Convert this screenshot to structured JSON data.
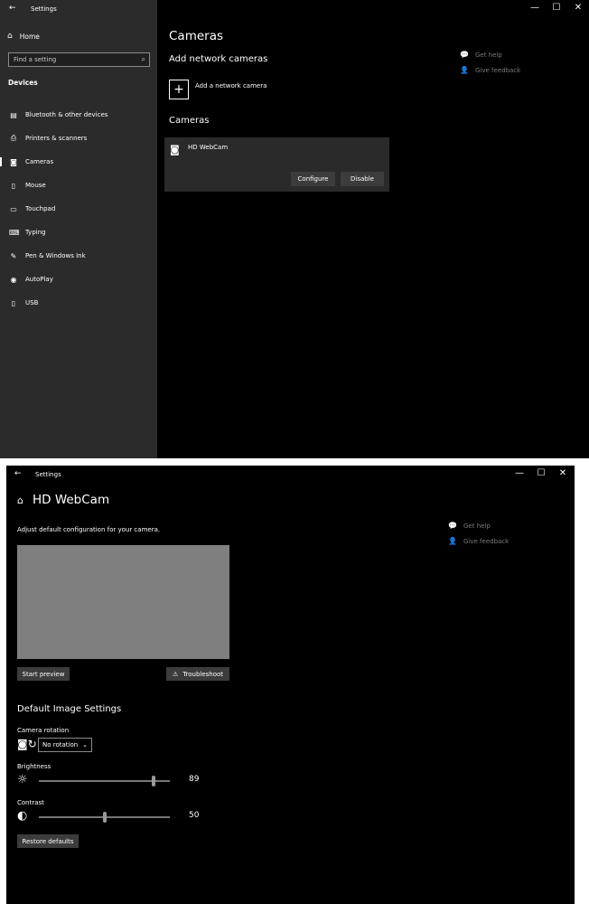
{
  "window1": {
    "title": "Settings",
    "controls": [
      "—",
      "☐",
      "✕"
    ],
    "sidebar": {
      "home": "Home",
      "search_placeholder": "Find a setting",
      "section": "Devices",
      "items": [
        {
          "icon": "bluetooth-icon",
          "glyph": "▤",
          "label": "Bluetooth & other devices"
        },
        {
          "icon": "printer-icon",
          "glyph": "⎙",
          "label": "Printers & scanners"
        },
        {
          "icon": "camera-icon",
          "glyph": "◙",
          "label": "Cameras"
        },
        {
          "icon": "mouse-icon",
          "glyph": "▯",
          "label": "Mouse"
        },
        {
          "icon": "touchpad-icon",
          "glyph": "▭",
          "label": "Touchpad"
        },
        {
          "icon": "keyboard-icon",
          "glyph": "⌨",
          "label": "Typing"
        },
        {
          "icon": "pen-icon",
          "glyph": "✎",
          "label": "Pen & Windows Ink"
        },
        {
          "icon": "autoplay-icon",
          "glyph": "◉",
          "label": "AutoPlay"
        },
        {
          "icon": "usb-icon",
          "glyph": "▯",
          "label": "USB"
        }
      ]
    },
    "main": {
      "title": "Cameras",
      "add_heading": "Add network cameras",
      "add_label": "Add a network camera",
      "cameras_heading": "Cameras",
      "camera_name": "HD WebCam",
      "configure": "Configure",
      "disable": "Disable"
    },
    "help": {
      "get_help": "Get help",
      "feedback": "Give feedback"
    }
  },
  "window2": {
    "title": "Settings",
    "controls": [
      "—",
      "☐",
      "✕"
    ],
    "header": "HD WebCam",
    "description": "Adjust default configuration for your camera.",
    "start_preview": "Start preview",
    "troubleshoot": "Troubleshoot",
    "section": "Default Image Settings",
    "rotation_label": "Camera rotation",
    "rotation_value": "No rotation",
    "brightness_label": "Brightness",
    "brightness_value": "89",
    "contrast_label": "Contrast",
    "contrast_value": "50",
    "restore": "Restore defaults",
    "help": {
      "get_help": "Get help",
      "feedback": "Give feedback"
    }
  }
}
